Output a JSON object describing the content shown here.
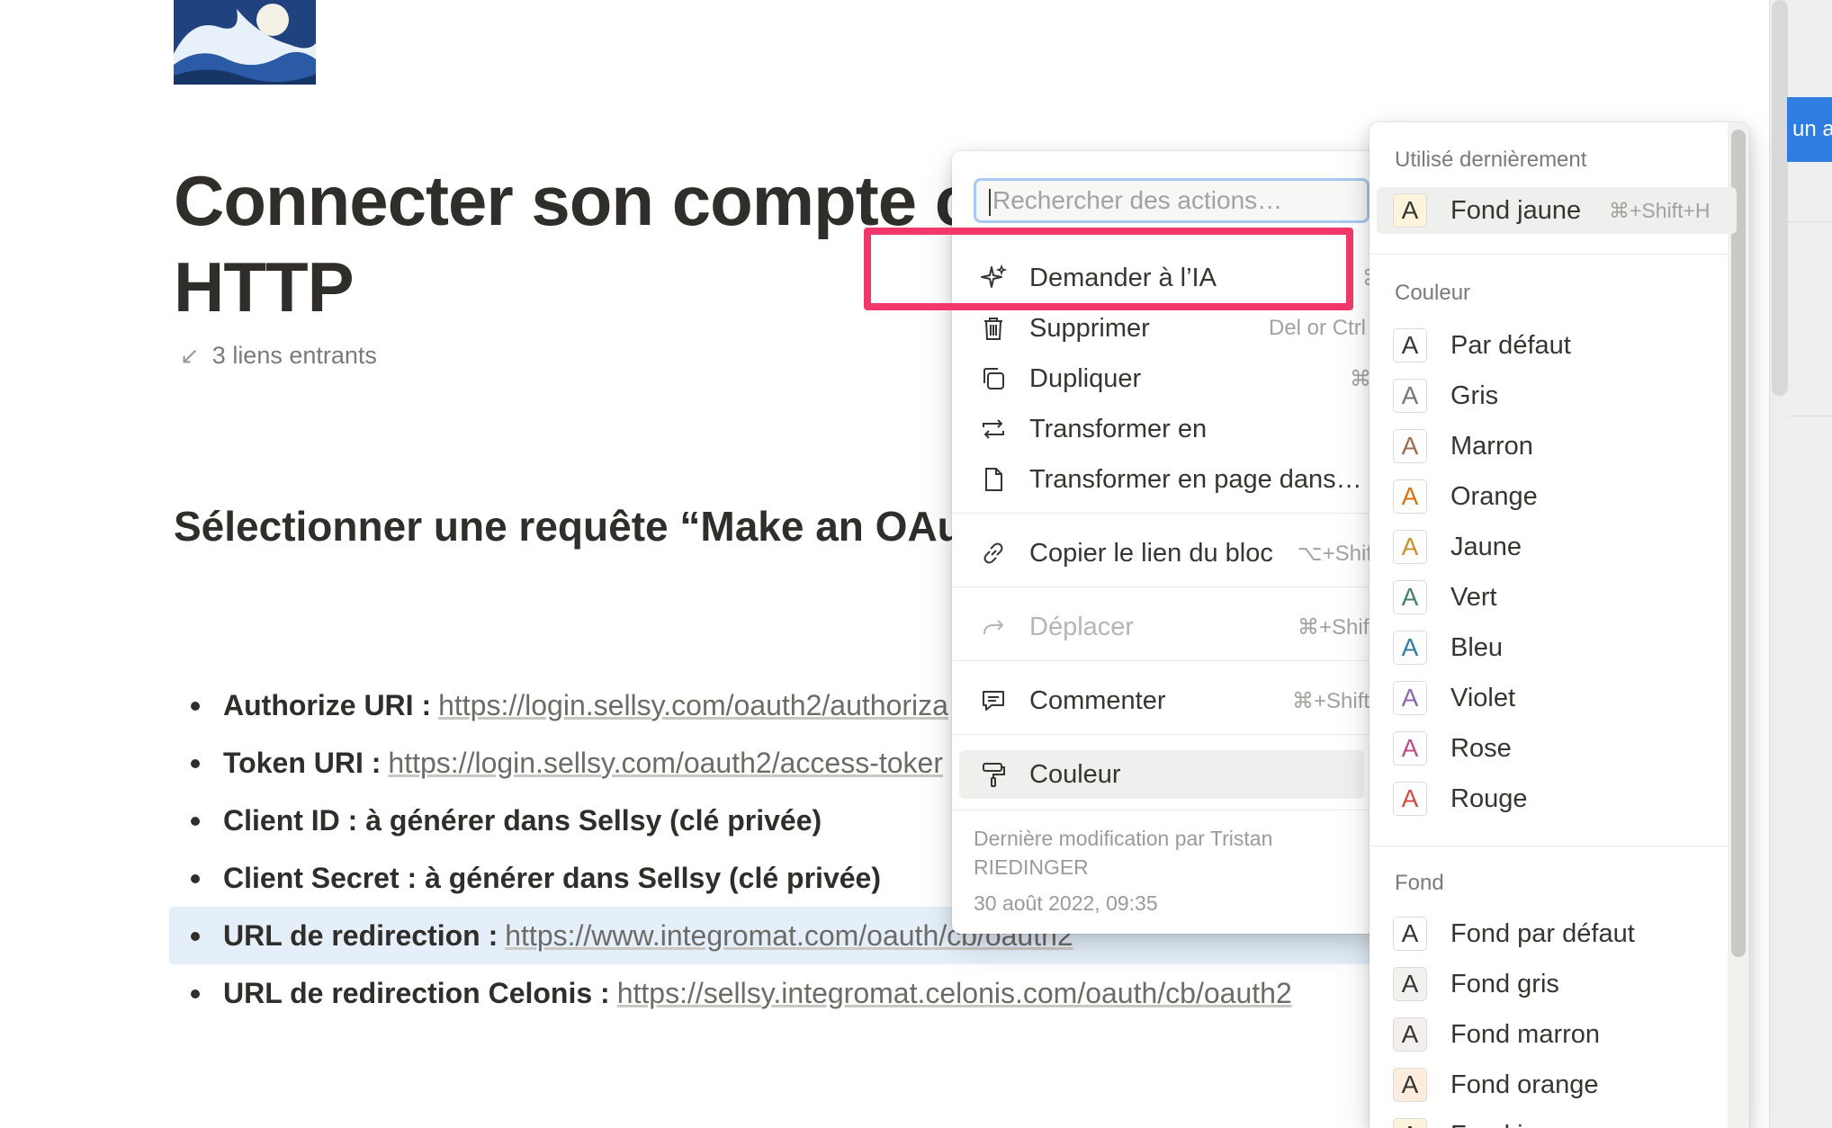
{
  "page": {
    "title_line1": "Connecter son compte c",
    "title_line2": "HTTP",
    "backlinks": "3 liens entrants",
    "section_heading": "Sélectionner une requête “Make an OAut",
    "bullets": [
      {
        "label": "Authorize URI :",
        "link": "https://login.sellsy.com/oauth2/authoriza"
      },
      {
        "label": "Token URI :",
        "link": "https://login.sellsy.com/oauth2/access-toker"
      },
      {
        "label": "Client ID : à générer dans Sellsy (clé privée)",
        "link": ""
      },
      {
        "label": "Client Secret : à générer dans Sellsy (clé privée)",
        "link": ""
      },
      {
        "label": "URL de redirection  :",
        "link": "https://www.integromat.com/oauth/cb/oauth2"
      },
      {
        "label": "URL de redirection Celonis :",
        "link": "https://sellsy.integromat.celonis.com/oauth/cb/oauth2"
      }
    ]
  },
  "side_strip": {
    "pill_text": "un a"
  },
  "context_menu": {
    "search_placeholder": "Rechercher des actions…",
    "items": [
      {
        "label": "Demander à l’IA",
        "shortcut": "⌘",
        "icon": "sparkle-icon"
      },
      {
        "label": "Supprimer",
        "shortcut": "Del or Ctrl",
        "icon": "trash-icon"
      },
      {
        "label": "Dupliquer",
        "shortcut": "⌘",
        "icon": "duplicate-icon"
      },
      {
        "label": "Transformer en",
        "shortcut": "",
        "icon": "transform-icon"
      },
      {
        "label": "Transformer en page dans…",
        "shortcut": "",
        "icon": "page-icon"
      },
      {
        "label": "Copier le lien du bloc",
        "shortcut": "⌥+Shift",
        "icon": "link-icon"
      },
      {
        "label": "Déplacer",
        "shortcut": "⌘+Shift",
        "icon": "move-arrow-icon"
      },
      {
        "label": "Commenter",
        "shortcut": "⌘+Shift",
        "icon": "comment-icon"
      },
      {
        "label": "Couleur",
        "shortcut": "",
        "icon": "paint-roller-icon"
      }
    ],
    "meta_edited": "Dernière modification par Tristan RIEDINGER",
    "meta_date": "30 août 2022, 09:35"
  },
  "color_menu": {
    "recent_title": "Utilisé dernièrement",
    "recent": {
      "label": "Fond jaune",
      "shortcut": "⌘+Shift+H",
      "text_color": "#37352f",
      "bg": "#fbf3db"
    },
    "text_title": "Couleur",
    "text_colors": [
      {
        "label": "Par défaut",
        "color": "#37352f"
      },
      {
        "label": "Gris",
        "color": "#787774"
      },
      {
        "label": "Marron",
        "color": "#9f6b53"
      },
      {
        "label": "Orange",
        "color": "#d9730d"
      },
      {
        "label": "Jaune",
        "color": "#cb912f"
      },
      {
        "label": "Vert",
        "color": "#448361"
      },
      {
        "label": "Bleu",
        "color": "#337ea9"
      },
      {
        "label": "Violet",
        "color": "#9065b0"
      },
      {
        "label": "Rose",
        "color": "#c14c8a"
      },
      {
        "label": "Rouge",
        "color": "#d44c47"
      }
    ],
    "bg_title": "Fond",
    "bg_colors": [
      {
        "label": "Fond par défaut",
        "bg": "#ffffff"
      },
      {
        "label": "Fond gris",
        "bg": "#f1f1ef"
      },
      {
        "label": "Fond marron",
        "bg": "#f4eeee"
      },
      {
        "label": "Fond orange",
        "bg": "#fbecdd"
      },
      {
        "label": "Fond ja",
        "bg": "#fbf3db"
      }
    ]
  }
}
